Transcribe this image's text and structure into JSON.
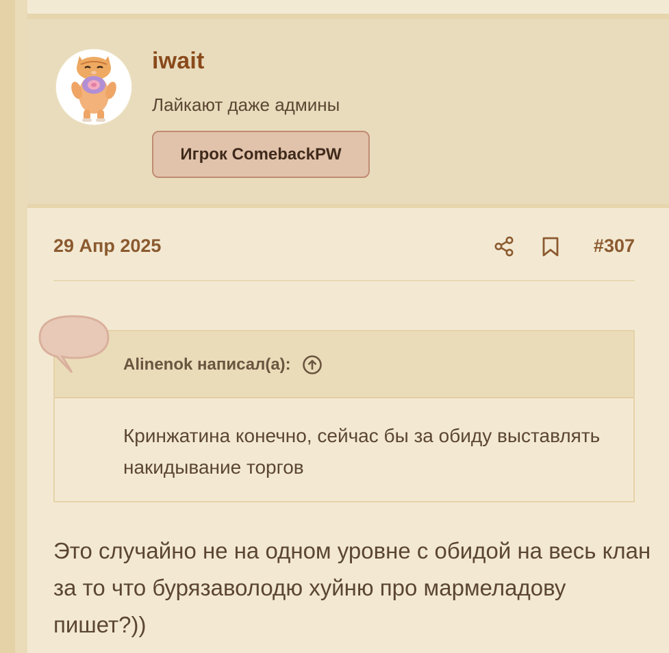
{
  "post": {
    "author": {
      "username": "iwait",
      "title": "Лайкают даже админы",
      "badge": "Игрок ComebackPW",
      "avatar_icon": "cat-avatar"
    },
    "date": "29 Апр 2025",
    "number": "#307",
    "actions": {
      "share_icon": "share-icon",
      "bookmark_icon": "bookmark-icon"
    },
    "quote": {
      "author_line": "Alinenok написал(а):",
      "goto_icon": "arrow-up-circle-icon",
      "text": "Кринжатина конечно, сейчас бы за обиду выставлять накидывание торгов"
    },
    "body": "Это случайно не на одном уровне с обидой на весь клан за то что бурязаволодю хуйню про мармеладову пишет?))"
  },
  "colors": {
    "accent": "#8a4a1c",
    "meta": "#8b5a2f",
    "text": "#5b4632",
    "badge_bg": "#e1c2aa",
    "badge_border": "#bf8b72",
    "quote_bubble": "#e8c9b7"
  }
}
